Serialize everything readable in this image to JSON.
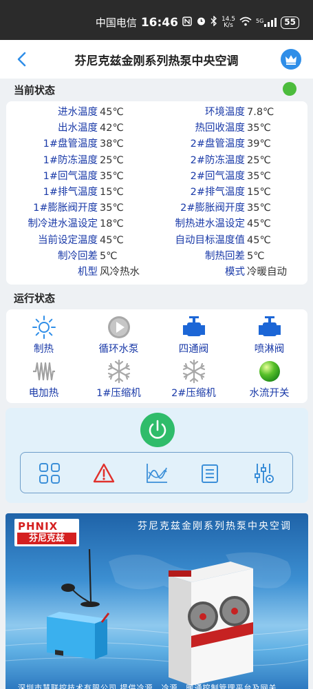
{
  "status_bar": {
    "carrier": "中国电信",
    "time": "16:46",
    "net_speed_top": "14.5",
    "net_speed_bottom": "K/s",
    "signal_label": "5G",
    "battery": "55"
  },
  "app": {
    "title": "芬尼克兹金刚系列热泵中央空调"
  },
  "current_state": {
    "title": "当前状态",
    "indicator_color": "#4cbc3c",
    "rows": [
      {
        "l1": "进水温度",
        "v1": "45℃",
        "l2": "环境温度",
        "v2": "7.8℃"
      },
      {
        "l1": "出水温度",
        "v1": "42℃",
        "l2": "热回收温度",
        "v2": "35℃"
      },
      {
        "l1": "1#盘管温度",
        "v1": "38℃",
        "l2": "2#盘管温度",
        "v2": "39℃"
      },
      {
        "l1": "1#防冻温度",
        "v1": "25℃",
        "l2": "2#防冻温度",
        "v2": "25℃"
      },
      {
        "l1": "1#回气温度",
        "v1": "35℃",
        "l2": "2#回气温度",
        "v2": "35℃"
      },
      {
        "l1": "1#排气温度",
        "v1": "15℃",
        "l2": "2#排气温度",
        "v2": "15℃"
      },
      {
        "l1": "1#膨胀阀开度",
        "v1": "35℃",
        "l2": "2#膨胀阀开度",
        "v2": "35℃"
      },
      {
        "l1": "制冷进水温设定",
        "v1": "18℃",
        "l2": "制热进水温设定",
        "v2": "45℃"
      },
      {
        "l1": "当前设定温度",
        "v1": "45℃",
        "l2": "自动目标温度值",
        "v2": "45℃"
      },
      {
        "l1": "制冷回差",
        "v1": "5℃",
        "l2": "制热回差",
        "v2": "5℃"
      },
      {
        "l1": "机型",
        "v1": "风冷热水",
        "l2": "模式",
        "v2": "冷暖自动"
      }
    ]
  },
  "run_state": {
    "title": "运行状态",
    "items": [
      {
        "label": "制热",
        "icon": "sun-icon"
      },
      {
        "label": "循环水泵",
        "icon": "pump-play-icon"
      },
      {
        "label": "四通阀",
        "icon": "valve-icon"
      },
      {
        "label": "喷淋阀",
        "icon": "spray-valve-icon"
      },
      {
        "label": "电加热",
        "icon": "heater-coil-icon"
      },
      {
        "label": "1#压缩机",
        "icon": "snowflake-icon"
      },
      {
        "label": "2#压缩机",
        "icon": "snowflake-icon"
      },
      {
        "label": "水流开关",
        "icon": "green-ball-icon"
      }
    ]
  },
  "controls": {
    "power_icon": "power-icon",
    "tools": [
      "grid-icon",
      "warning-icon",
      "curve-chart-icon",
      "list-icon",
      "settings-sliders-icon"
    ]
  },
  "banner": {
    "logo_en": "PHNIX",
    "logo_cn": "芬尼克兹",
    "title": "芬尼克兹金刚系列热泵中央空调",
    "footer": "深圳市慧联控技术有限公司   提供冷源、冷源、暖通控制管理平台及网关"
  }
}
